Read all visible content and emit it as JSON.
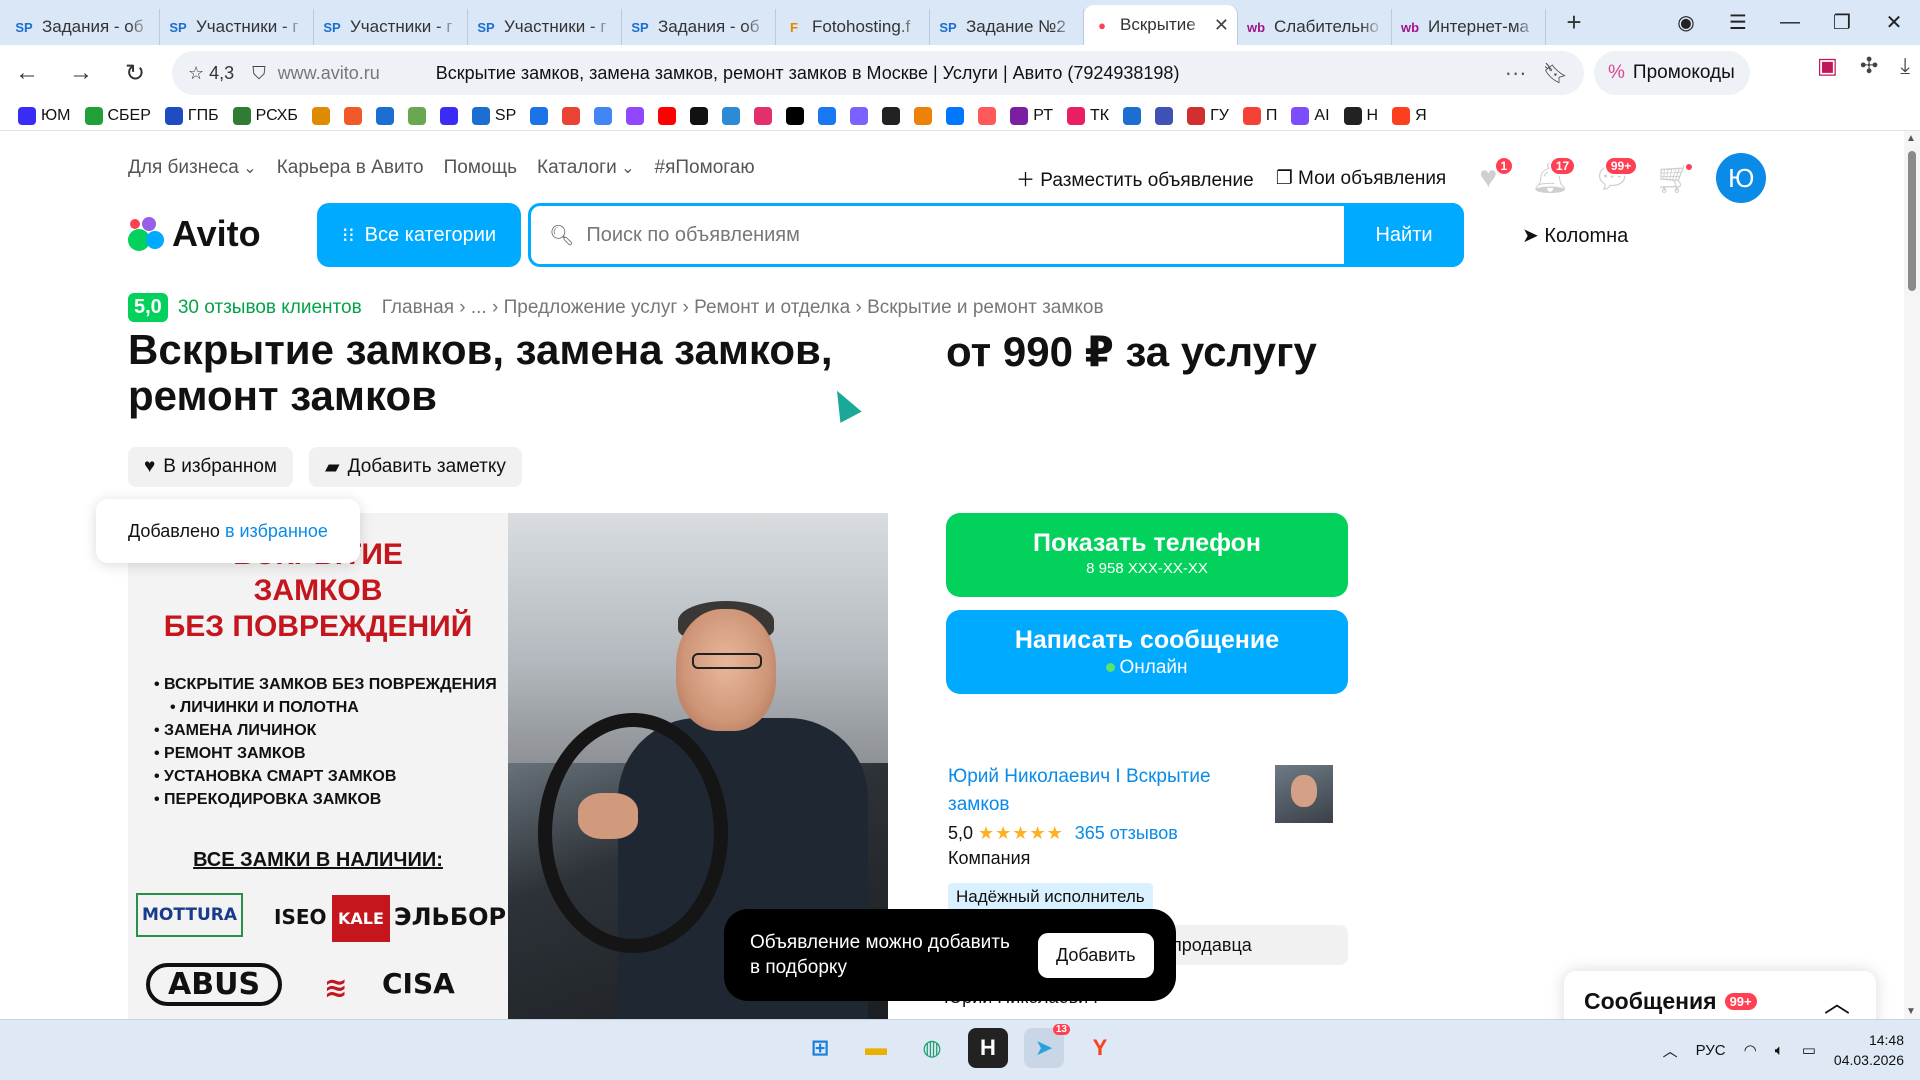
{
  "browser": {
    "tabs": [
      {
        "label": "Задания - об",
        "icon": "SP",
        "color": "#1a6fd1"
      },
      {
        "label": "Участники - г",
        "icon": "SP",
        "color": "#1a6fd1"
      },
      {
        "label": "Участники - г",
        "icon": "SP",
        "color": "#1a6fd1"
      },
      {
        "label": "Участники - г",
        "icon": "SP",
        "color": "#1a6fd1"
      },
      {
        "label": "Задания - об",
        "icon": "SP",
        "color": "#1a6fd1"
      },
      {
        "label": "Fotohosting.f",
        "icon": "F",
        "color": "#e08a00"
      },
      {
        "label": "Задание №2",
        "icon": "SP",
        "color": "#1a6fd1"
      },
      {
        "label": "Вскрытие",
        "icon": "●",
        "color": "#ff4053",
        "active": true
      },
      {
        "label": "Слабительно",
        "icon": "wb",
        "color": "#a1148c"
      },
      {
        "label": "Интернет-ма",
        "icon": "wb",
        "color": "#a1148c"
      }
    ],
    "url_rating": "4,3",
    "url_domain": "www.avito.ru",
    "page_title": "Вскрытие замков, замена замков, ремонт замков в Москве | Услуги | Авито (7924938198)",
    "promo_label": "Промокоды",
    "bookmarks": [
      {
        "label": "ЮМ",
        "color": "#3b2cf5"
      },
      {
        "label": "СБЕР",
        "color": "#21a038"
      },
      {
        "label": "ГПБ",
        "color": "#1f4cc2"
      },
      {
        "label": "РСХБ",
        "color": "#2e7d32"
      },
      {
        "label": "",
        "color": "#e08a00"
      },
      {
        "label": "",
        "color": "#f05a28"
      },
      {
        "label": "",
        "color": "#1a6fd1"
      },
      {
        "label": "",
        "color": "#6aa84f"
      },
      {
        "label": "",
        "color": "#3b2cf5"
      },
      {
        "label": "SP",
        "color": "#1a6fd1"
      },
      {
        "label": "",
        "color": "#1a73e8"
      },
      {
        "label": "",
        "color": "#ea4335"
      },
      {
        "label": "",
        "color": "#4285f4"
      },
      {
        "label": "",
        "color": "#9146ff"
      },
      {
        "label": "",
        "color": "#ff0000"
      },
      {
        "label": "",
        "color": "#111111"
      },
      {
        "label": "",
        "color": "#2b8bd6"
      },
      {
        "label": "",
        "color": "#e1306c"
      },
      {
        "label": "",
        "color": "#000000"
      },
      {
        "label": "",
        "color": "#1877f2"
      },
      {
        "label": "",
        "color": "#7b61ff"
      },
      {
        "label": "",
        "color": "#222222"
      },
      {
        "label": "",
        "color": "#ee8208"
      },
      {
        "label": "",
        "color": "#0077ff"
      },
      {
        "label": "",
        "color": "#ff5a5a"
      },
      {
        "label": "РТ",
        "color": "#7b1fa2"
      },
      {
        "label": "ТК",
        "color": "#e91e63"
      },
      {
        "label": "",
        "color": "#1a6fd1"
      },
      {
        "label": "",
        "color": "#3f51b5"
      },
      {
        "label": "ГУ",
        "color": "#d32f2f"
      },
      {
        "label": "П",
        "color": "#f44336"
      },
      {
        "label": "AI",
        "color": "#7c4dff"
      },
      {
        "label": "Н",
        "color": "#222222"
      },
      {
        "label": "Я",
        "color": "#fc3f1d"
      }
    ]
  },
  "site": {
    "topnav": [
      "Для бизнеса",
      "Карьера в Авито",
      "Помощь",
      "Каталоги",
      "#яПомогаю"
    ],
    "post_ad": "Разместить объявление",
    "my_ads": "Мои объявления",
    "favorites_count": "1",
    "notifications_count": "17",
    "messages_count": "99+",
    "avatar_letter": "Ю",
    "logo": "Avito",
    "all_categories": "Все категории",
    "search_placeholder": "Поиск по объявлениям",
    "find": "Найти",
    "location": "Колomна"
  },
  "listing": {
    "rating": "5,0",
    "reviews": "30 отзывов клиентов",
    "breadcrumbs": "Главная › ... › Предложение услуг › Ремонт и отделка › Вскрытие и ремонт замков",
    "title": "Вскрытие замков, замена замков, ремонт замков",
    "price": "от 990 ₽ за услугу",
    "in_favorites": "В избранном",
    "add_note": "Добавить заметку",
    "toast_text": "Добавлено",
    "toast_link": "в избранное",
    "show_phone": "Показать телефон",
    "phone_mask": "8 958 XXX-XX-XX",
    "write_message": "Написать сообщение",
    "online": "Онлайн",
    "image": {
      "title": "ВСКРЫТИЕ\nЗАМКОВ\nБЕЗ ПОВРЕЖДЕНИЙ",
      "bullets": [
        "ВСКРЫТИЕ ЗАМКОВ БЕЗ ПОВРЕЖДЕНИЯ",
        "ЛИЧИНКИ И ПОЛОТНА",
        "ЗАМЕНА ЛИЧИНОК",
        "РЕМОНТ ЗАМКОВ",
        "УСТАНОВКА СМАРТ ЗАМКОВ",
        "ПЕРЕКОДИРОВКА ЗАМКОВ"
      ],
      "stock": "ВСЕ ЗАМКИ В НАЛИЧИИ:",
      "brands": [
        "MOTTURA",
        "ISEO",
        "KALE",
        "ЭЛЬБОР",
        "ABUS",
        "CISA"
      ]
    }
  },
  "seller": {
    "name": "Юрий Николаевич I Вскрытие замков",
    "rating": "5,0",
    "stars": "★★★★★",
    "reviews": "365 отзывов",
    "type": "Компания",
    "trusted": "Надёжный исполнитель",
    "subscribe_partial": "продавца",
    "contact_partial": "Юрий Николаевич"
  },
  "snackbar": {
    "text": "Объявление можно добавить в подборку",
    "action": "Добавить"
  },
  "messages_widget": {
    "title": "Сообщения",
    "count": "99+"
  },
  "taskbar": {
    "telegram_badge": "13",
    "lang": "РУС",
    "time": "14:48",
    "date": "04.03.2026"
  }
}
